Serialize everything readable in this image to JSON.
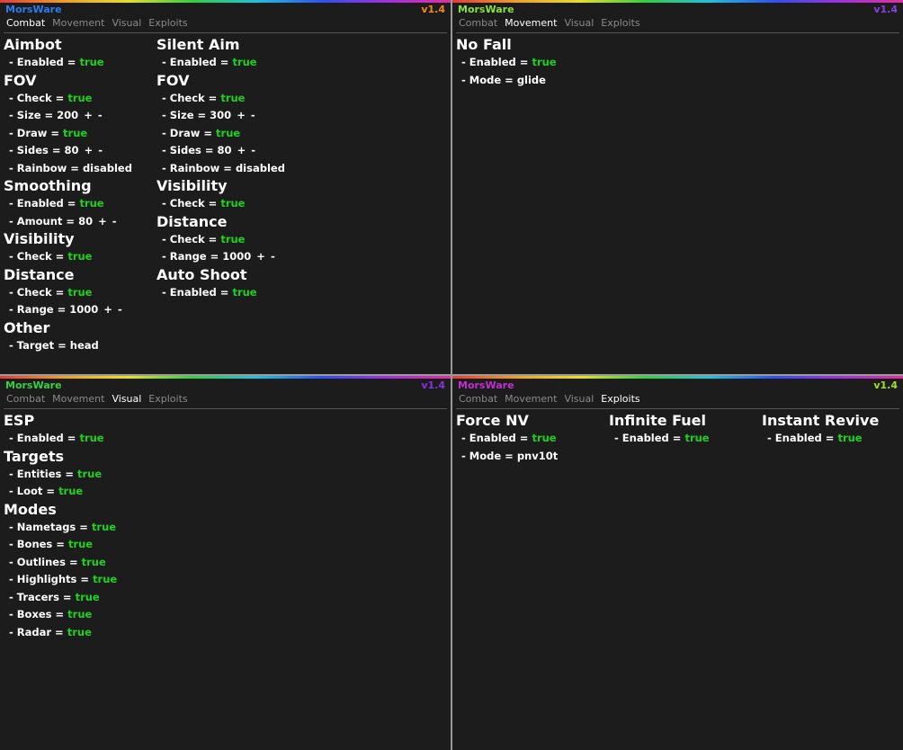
{
  "app": {
    "brand": "MorsWare",
    "version": "v1.4",
    "tabs": [
      "Combat",
      "Movement",
      "Visual",
      "Exploits"
    ]
  },
  "accents": {
    "p1_brand": "#2b7df0",
    "p1_version": "#f08a20",
    "p2_brand": "#8ae040",
    "p2_version": "#8a40e0",
    "p3_brand": "#38d040",
    "p3_version": "#8a30e0",
    "p4_brand": "#c030d0",
    "p4_version": "#a0e030",
    "true_color": "#1ed21e"
  },
  "combat": {
    "aimbot": {
      "title": "Aimbot",
      "enabled": {
        "label": "- Enabled =",
        "value": "true"
      },
      "fov_title": "FOV",
      "fov_check": {
        "label": "- Check =",
        "value": "true"
      },
      "fov_size": {
        "label": "- Size =",
        "value": "200"
      },
      "fov_draw": {
        "label": "- Draw =",
        "value": "true"
      },
      "fov_sides": {
        "label": "- Sides =",
        "value": "80"
      },
      "fov_rainbow": {
        "label": "- Rainbow =",
        "value": "disabled"
      },
      "smoothing_title": "Smoothing",
      "smoothing_enabled": {
        "label": "- Enabled =",
        "value": "true"
      },
      "smoothing_amount": {
        "label": "- Amount =",
        "value": "80"
      },
      "visibility_title": "Visibility",
      "visibility_check": {
        "label": "- Check =",
        "value": "true"
      },
      "distance_title": "Distance",
      "distance_check": {
        "label": "- Check =",
        "value": "true"
      },
      "distance_range": {
        "label": "- Range =",
        "value": "1000"
      },
      "other_title": "Other",
      "other_target": {
        "label": "- Target =",
        "value": "head"
      }
    },
    "silent": {
      "title": "Silent Aim",
      "enabled": {
        "label": "- Enabled =",
        "value": "true"
      },
      "fov_title": "FOV",
      "fov_check": {
        "label": "- Check =",
        "value": "true"
      },
      "fov_size": {
        "label": "- Size =",
        "value": "300"
      },
      "fov_draw": {
        "label": "- Draw =",
        "value": "true"
      },
      "fov_sides": {
        "label": "- Sides =",
        "value": "80"
      },
      "fov_rainbow": {
        "label": "- Rainbow =",
        "value": "disabled"
      },
      "visibility_title": "Visibility",
      "visibility_check": {
        "label": "- Check =",
        "value": "true"
      },
      "distance_title": "Distance",
      "distance_check": {
        "label": "- Check =",
        "value": "true"
      },
      "distance_range": {
        "label": "- Range =",
        "value": "1000"
      },
      "autoshoot_title": "Auto Shoot",
      "autoshoot_enabled": {
        "label": "- Enabled =",
        "value": "true"
      }
    },
    "plus": "+",
    "minus": "-"
  },
  "movement": {
    "nofall_title": "No Fall",
    "nofall_enabled": {
      "label": "- Enabled =",
      "value": "true"
    },
    "nofall_mode": {
      "label": "- Mode =",
      "value": "glide"
    }
  },
  "visual": {
    "esp_title": "ESP",
    "esp_enabled": {
      "label": "- Enabled =",
      "value": "true"
    },
    "targets_title": "Targets",
    "entities": {
      "label": "- Entities =",
      "value": "true"
    },
    "loot": {
      "label": "- Loot =",
      "value": "true"
    },
    "modes_title": "Modes",
    "nametags": {
      "label": "- Nametags =",
      "value": "true"
    },
    "bones": {
      "label": "- Bones =",
      "value": "true"
    },
    "outlines": {
      "label": "- Outlines =",
      "value": "true"
    },
    "highlights": {
      "label": "- Highlights =",
      "value": "true"
    },
    "tracers": {
      "label": "- Tracers =",
      "value": "true"
    },
    "boxes": {
      "label": "- Boxes =",
      "value": "true"
    },
    "radar": {
      "label": "- Radar =",
      "value": "true"
    }
  },
  "exploits": {
    "forcenv_title": "Force NV",
    "forcenv_enabled": {
      "label": "- Enabled =",
      "value": "true"
    },
    "forcenv_mode": {
      "label": "- Mode =",
      "value": "pnv10t"
    },
    "fuel_title": "Infinite Fuel",
    "fuel_enabled": {
      "label": "- Enabled =",
      "value": "true"
    },
    "revive_title": "Instant Revive",
    "revive_enabled": {
      "label": "- Enabled =",
      "value": "true"
    }
  }
}
